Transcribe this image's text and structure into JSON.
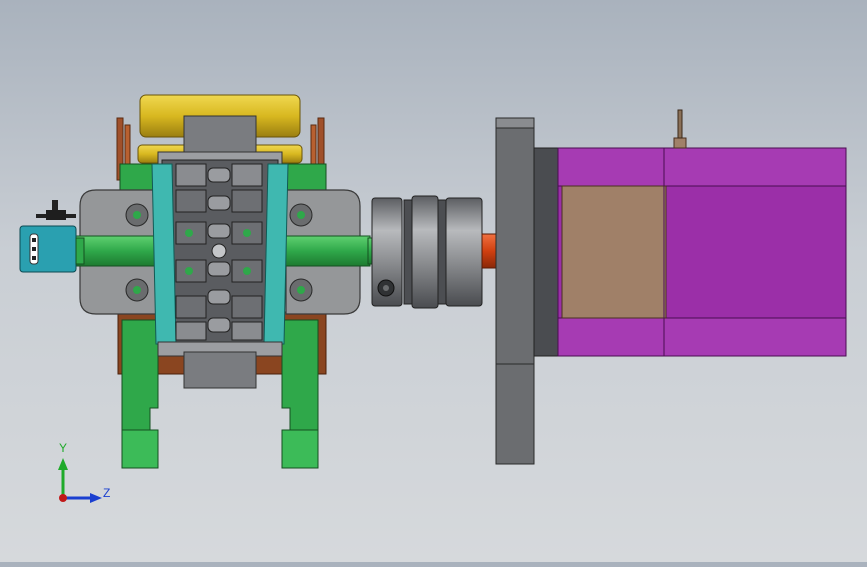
{
  "viewport": {
    "background_top": "#a9b2bd",
    "background_bottom": "#d6d9dc"
  },
  "colors": {
    "frame_green": "#2fa84a",
    "frame_green_dark": "#1d7a30",
    "cam_gold": "#d8b820",
    "bracket_copper": "#a0502a",
    "housing_gray": "#8e8e8e",
    "clamp_cyan": "#3fb8b0",
    "coupling_gray": "#7d7f82",
    "shaft_red": "#d04010",
    "motor_plate_gray": "#6b6d70",
    "motor_magenta": "#9b2fa8",
    "motor_tan": "#a08068",
    "sensor_teal": "#2aa0b0"
  },
  "parts": [
    {
      "name": "gearbox-assembly",
      "icon": "gearbox-icon"
    },
    {
      "name": "flexible-coupling",
      "icon": "coupling-icon"
    },
    {
      "name": "stepper-motor",
      "icon": "motor-icon"
    },
    {
      "name": "limit-sensor",
      "icon": "sensor-icon"
    }
  ],
  "triad": {
    "y_label": "Y",
    "z_label": "Z",
    "y_color": "#1faa2a",
    "z_color": "#1a3fd0",
    "origin_color": "#c01818"
  }
}
